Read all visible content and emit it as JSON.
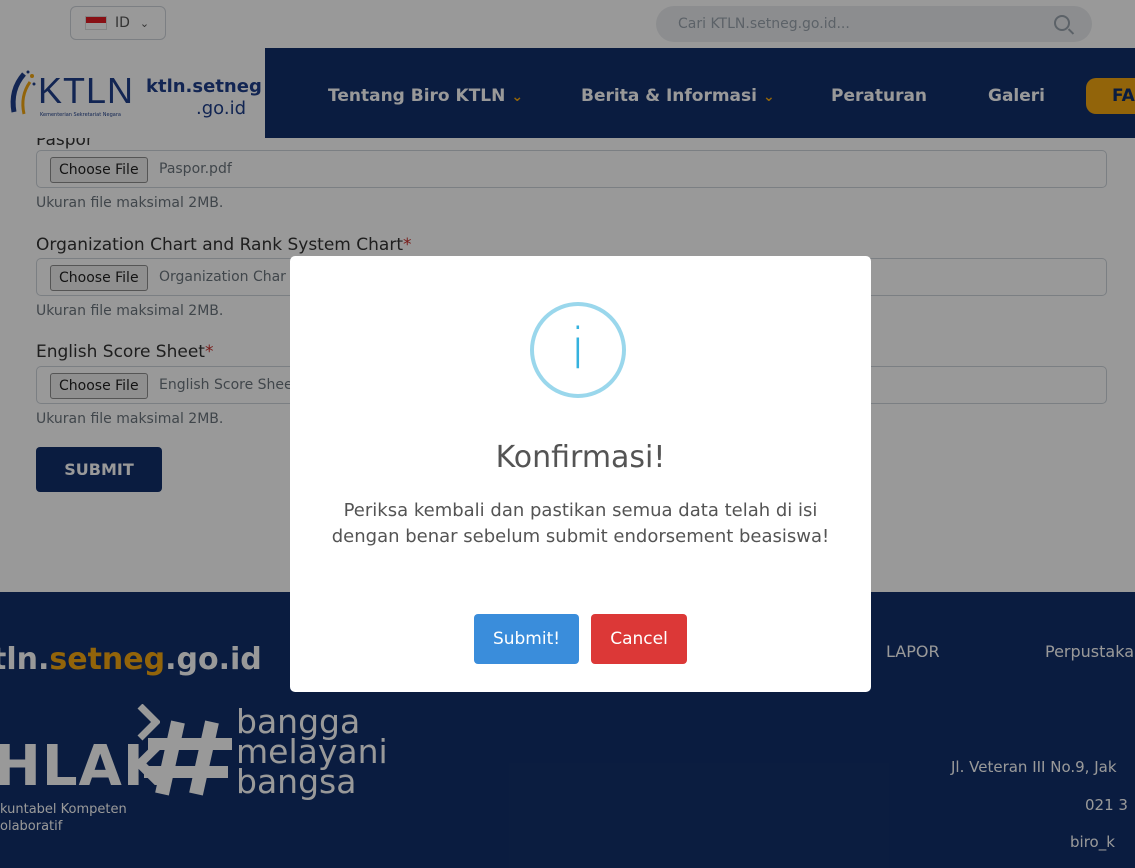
{
  "topbar": {
    "language": "ID",
    "search_placeholder": "Cari KTLN.setneg.go.id..."
  },
  "navbar": {
    "logo_text": "KTLN",
    "logo_subtext": "Kementerian Sekretariat Negara",
    "logo_domain_line1": "ktln.setneg",
    "logo_domain_line2": ".go.id",
    "items": [
      {
        "label": "Tentang Biro KTLN",
        "dropdown": true
      },
      {
        "label": "Berita & Informasi",
        "dropdown": true
      },
      {
        "label": "Peraturan",
        "dropdown": false
      },
      {
        "label": "Galeri",
        "dropdown": false
      }
    ],
    "faq_label": "FA"
  },
  "form": {
    "fields": [
      {
        "label": "Paspor",
        "required": false,
        "button": "Choose File",
        "file": "Paspor.pdf",
        "help": "Ukuran file maksimal 2MB."
      },
      {
        "label": "Organization Chart and Rank System Chart",
        "required": true,
        "button": "Choose File",
        "file": "Organization Char",
        "help": "Ukuran file maksimal 2MB."
      },
      {
        "label": "English Score Sheet",
        "required": true,
        "button": "Choose File",
        "file": "English Score Shee",
        "help": "Ukuran file maksimal 2MB."
      }
    ],
    "required_mark": "*",
    "submit_label": "SUBMIT"
  },
  "footer": {
    "domain_prefix": "tln.",
    "domain_accent": "setneg",
    "domain_suffix": ".go.id",
    "links": [
      "LAPOR",
      "Perpustaka"
    ],
    "akhlak": "HLAK",
    "akhlak_tagline_1": "kuntabel Kompeten",
    "akhlak_tagline_2": "olaboratif",
    "bangga_lines": [
      "bangga",
      "melayani",
      "bangsa"
    ],
    "address": "Jl. Veteran III No.9, Jak",
    "phone": "021 3",
    "email": "biro_k"
  },
  "modal": {
    "icon": "info-icon",
    "icon_glyph": "i",
    "title": "Konfirmasi!",
    "message": "Periksa kembali dan pastikan semua data telah di isi dengan benar sebelum submit endorsement beasiswa!",
    "confirm_label": "Submit!",
    "cancel_label": "Cancel"
  },
  "colors": {
    "navy": "#12306b",
    "accent": "#f3a712",
    "confirm": "#3a8ddb",
    "cancel": "#dc3837",
    "info": "#35b2de"
  }
}
